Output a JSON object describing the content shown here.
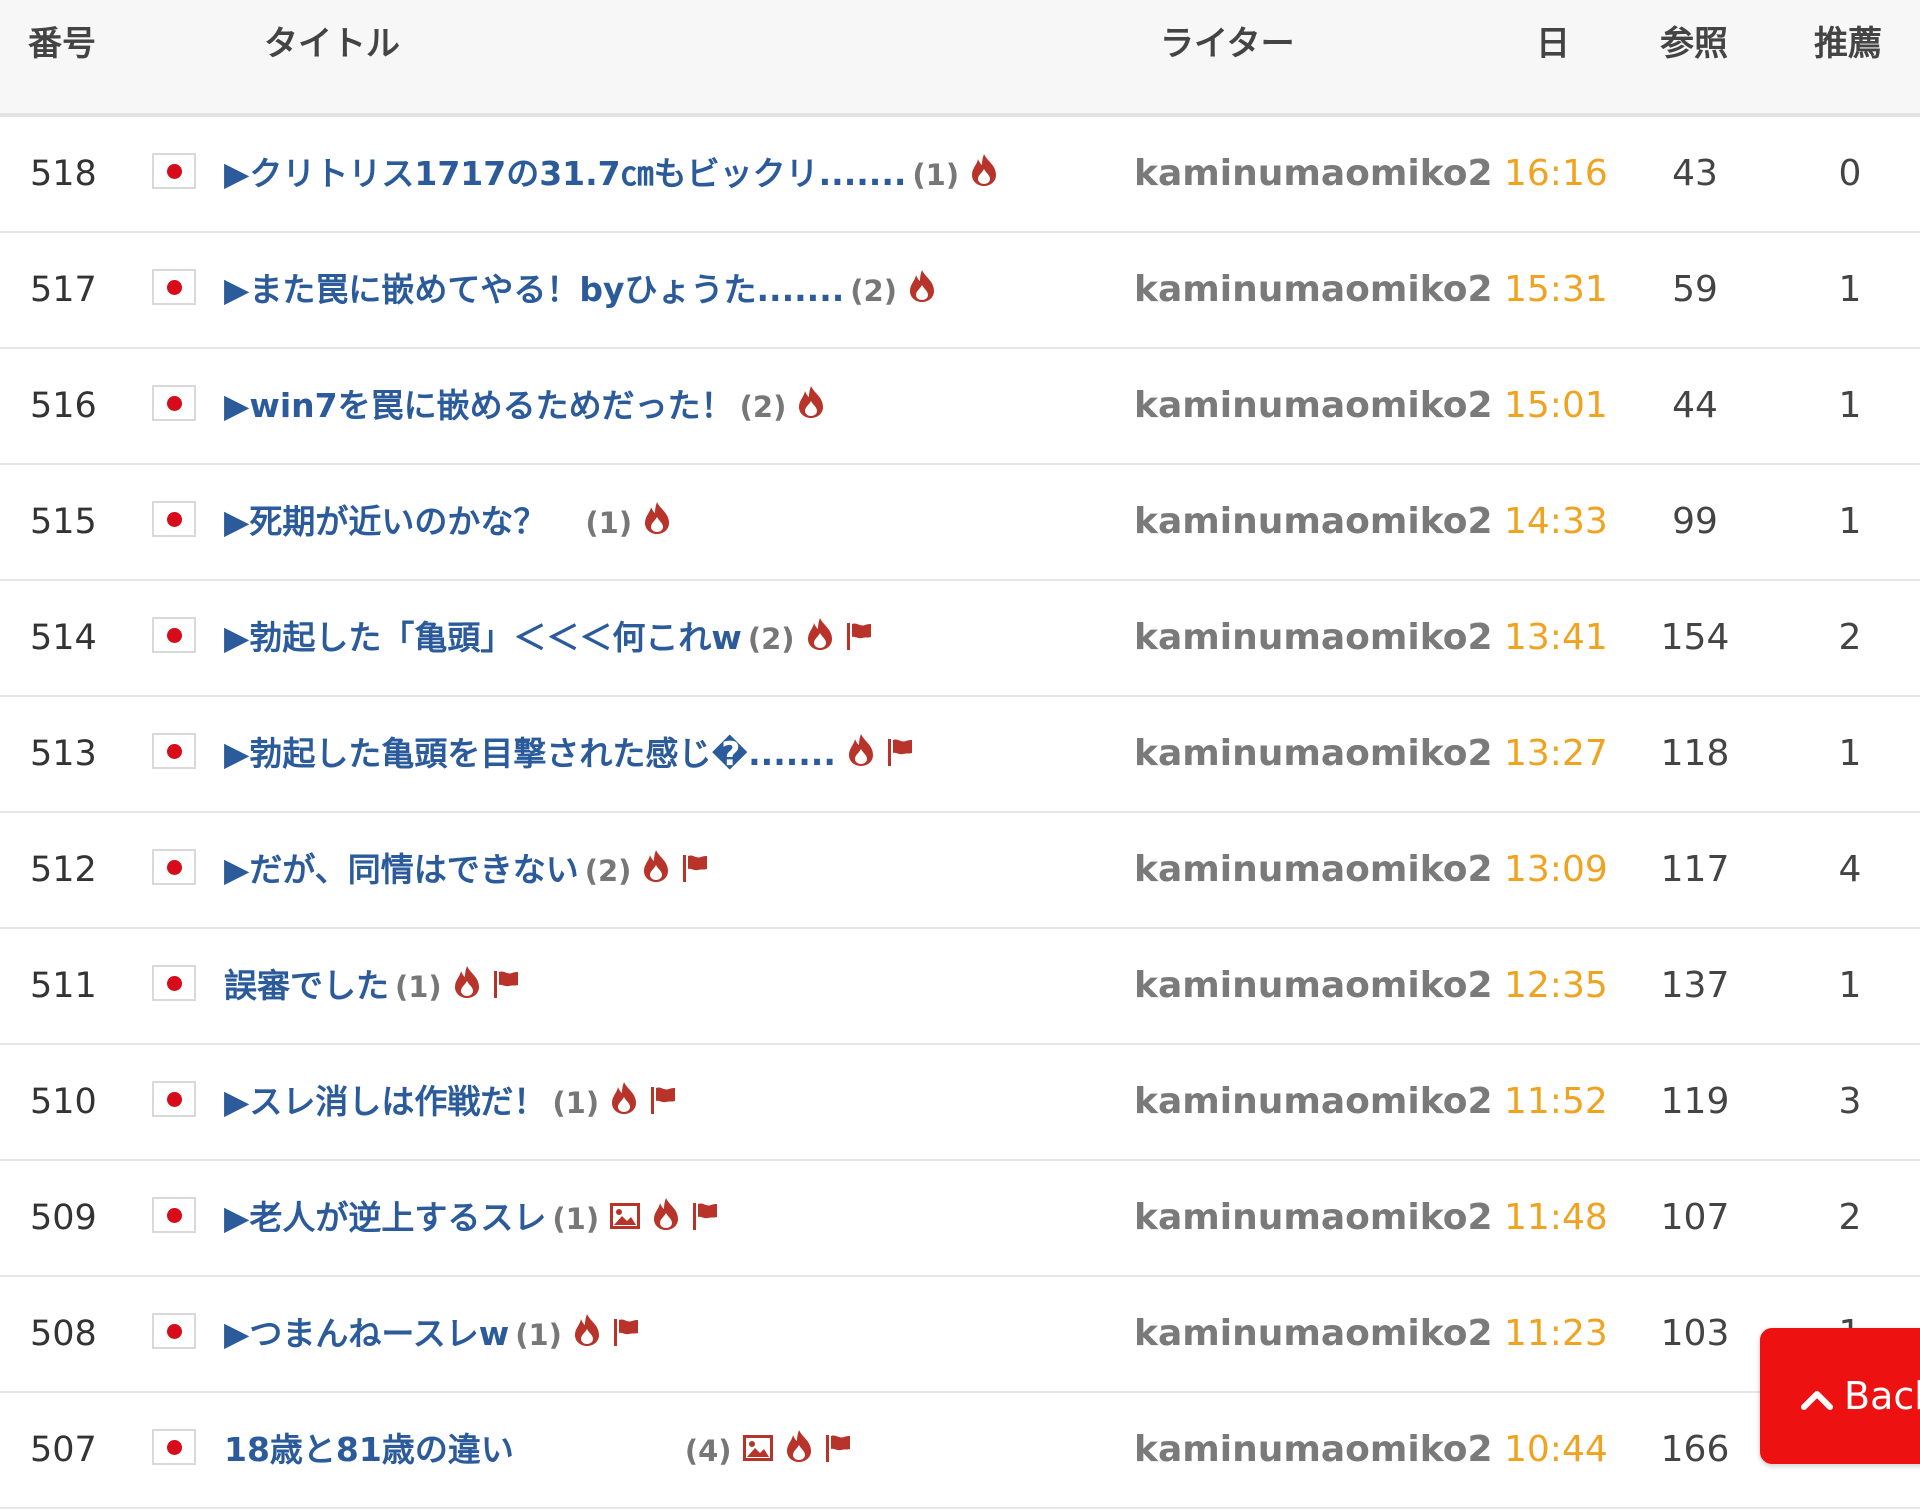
{
  "header": {
    "col_number": "番号",
    "col_title": "タイトル",
    "col_writer": "ライター",
    "col_date": "日",
    "col_views": "参照",
    "col_recommend": "推薦"
  },
  "posts": [
    {
      "number": "518",
      "title": "▶クリトリス1717の31.7㎝もビックリ.......",
      "count": "(1)",
      "image": false,
      "flag": false,
      "writer": "kaminumaomiko2",
      "date": "16:16",
      "views": "43",
      "recommend": "0"
    },
    {
      "number": "517",
      "title": "▶また罠に嵌めてやる！byひょうた.......",
      "count": "(2)",
      "image": false,
      "flag": false,
      "writer": "kaminumaomiko2",
      "date": "15:31",
      "views": "59",
      "recommend": "1"
    },
    {
      "number": "516",
      "title": "▶win7を罠に嵌めるためだった！",
      "count": "(2)",
      "image": false,
      "flag": false,
      "writer": "kaminumaomiko2",
      "date": "15:01",
      "views": "44",
      "recommend": "1"
    },
    {
      "number": "515",
      "title": "▶死期が近いのかな？　",
      "count": "(1)",
      "image": false,
      "flag": false,
      "writer": "kaminumaomiko2",
      "date": "14:33",
      "views": "99",
      "recommend": "1"
    },
    {
      "number": "514",
      "title": "▶勃起した「亀頭」＜＜＜何これw",
      "count": "(2)",
      "image": false,
      "flag": true,
      "writer": "kaminumaomiko2",
      "date": "13:41",
      "views": "154",
      "recommend": "2"
    },
    {
      "number": "513",
      "title": "▶勃起した亀頭を目撃された感じ�.......",
      "count": "",
      "image": false,
      "flag": true,
      "writer": "kaminumaomiko2",
      "date": "13:27",
      "views": "118",
      "recommend": "1"
    },
    {
      "number": "512",
      "title": "▶だが、同情はできない",
      "count": "(2)",
      "image": false,
      "flag": true,
      "writer": "kaminumaomiko2",
      "date": "13:09",
      "views": "117",
      "recommend": "4"
    },
    {
      "number": "511",
      "title": "誤審でした",
      "count": "(1)",
      "image": false,
      "flag": true,
      "writer": "kaminumaomiko2",
      "date": "12:35",
      "views": "137",
      "recommend": "1"
    },
    {
      "number": "510",
      "title": "▶スレ消しは作戦だ！",
      "count": "(1)",
      "image": false,
      "flag": true,
      "writer": "kaminumaomiko2",
      "date": "11:52",
      "views": "119",
      "recommend": "3"
    },
    {
      "number": "509",
      "title": "▶老人が逆上するスレ",
      "count": "(1)",
      "image": true,
      "flag": true,
      "writer": "kaminumaomiko2",
      "date": "11:48",
      "views": "107",
      "recommend": "2"
    },
    {
      "number": "508",
      "title": "▶つまんねースレw",
      "count": "(1)",
      "image": false,
      "flag": true,
      "writer": "kaminumaomiko2",
      "date": "11:23",
      "views": "103",
      "recommend": "1"
    },
    {
      "number": "507",
      "title": "18歳と81歳の違い　　　　　",
      "count": "(4)",
      "image": true,
      "flag": true,
      "writer": "kaminumaomiko2",
      "date": "10:44",
      "views": "166",
      "recommend": ""
    }
  ],
  "back_button": {
    "label": "Back"
  },
  "icons": {
    "hot": "fire-icon",
    "flagged": "flag-icon",
    "photo": "image-icon",
    "back": "chevron-up-icon"
  },
  "colors": {
    "title": "#2b5b9a",
    "date": "#f0a321",
    "hot": "#b8342a",
    "back": "#ee1111"
  }
}
